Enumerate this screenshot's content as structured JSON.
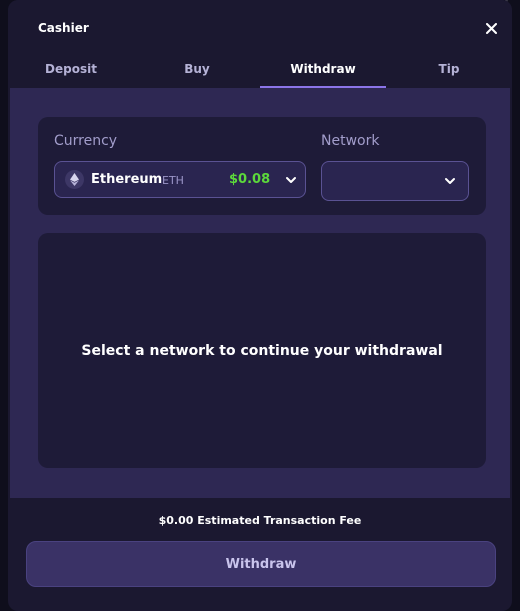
{
  "modal": {
    "title": "Cashier"
  },
  "tabs": [
    {
      "label": "Deposit",
      "active": false
    },
    {
      "label": "Buy",
      "active": false
    },
    {
      "label": "Withdraw",
      "active": true
    },
    {
      "label": "Tip",
      "active": false
    }
  ],
  "currency": {
    "label": "Currency",
    "name": "Ethereum",
    "ticker": "ETH",
    "balance": "$0.08",
    "icon": "ethereum-icon"
  },
  "network": {
    "label": "Network",
    "value": ""
  },
  "message": {
    "text": "Select a network to continue your withdrawal"
  },
  "fee": {
    "text": "$0.00 Estimated Transaction Fee"
  },
  "actions": {
    "withdraw_label": "Withdraw"
  },
  "colors": {
    "accent": "#8b74e8",
    "balance_green": "#5cd83b",
    "panel": "#2e2853",
    "card": "#1e1b38"
  }
}
